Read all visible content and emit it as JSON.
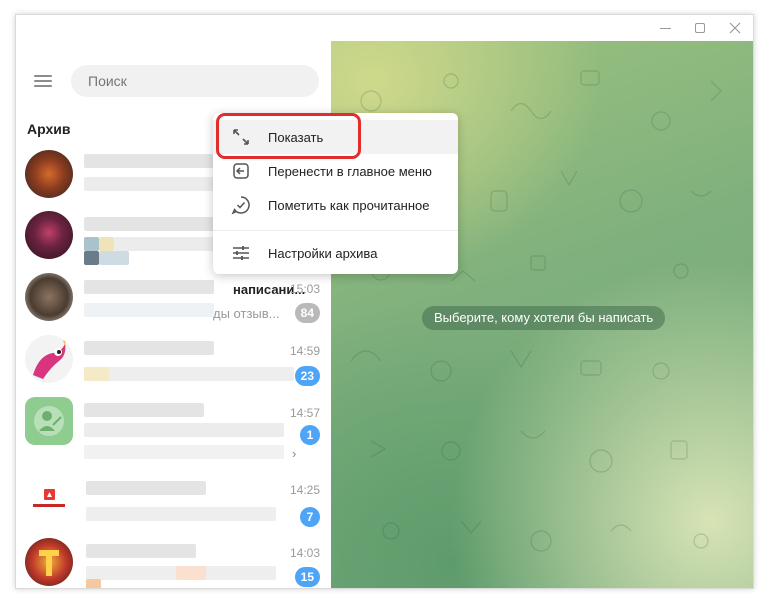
{
  "search": {
    "placeholder": "Поиск"
  },
  "archive": {
    "title": "Архив"
  },
  "chats": [
    {
      "time": "",
      "badge": ""
    },
    {
      "time": "",
      "badge": ""
    },
    {
      "time": "15:03",
      "badge": "84",
      "partial_name": "написани...",
      "partial_msg": "ды отзыв..."
    },
    {
      "time": "14:59",
      "badge": "23"
    },
    {
      "time": "14:57",
      "badge": "1"
    },
    {
      "time": "14:25",
      "badge": "7"
    },
    {
      "time": "14:03",
      "badge": "15"
    }
  ],
  "empty_state": "Выберите, кому хотели бы написать",
  "context_menu": {
    "items": [
      {
        "label": "Показать",
        "icon": "expand-icon"
      },
      {
        "label": "Перенести в главное меню",
        "icon": "move-to-main-icon"
      },
      {
        "label": "Пометить как прочитанное",
        "icon": "check-circle-icon"
      },
      {
        "label": "Настройки архива",
        "icon": "sliders-icon"
      }
    ]
  },
  "colors": {
    "badge_blue": "#4ea4f6",
    "highlight_red": "#e52c2c",
    "badge_muted": "#b9b9b9"
  }
}
